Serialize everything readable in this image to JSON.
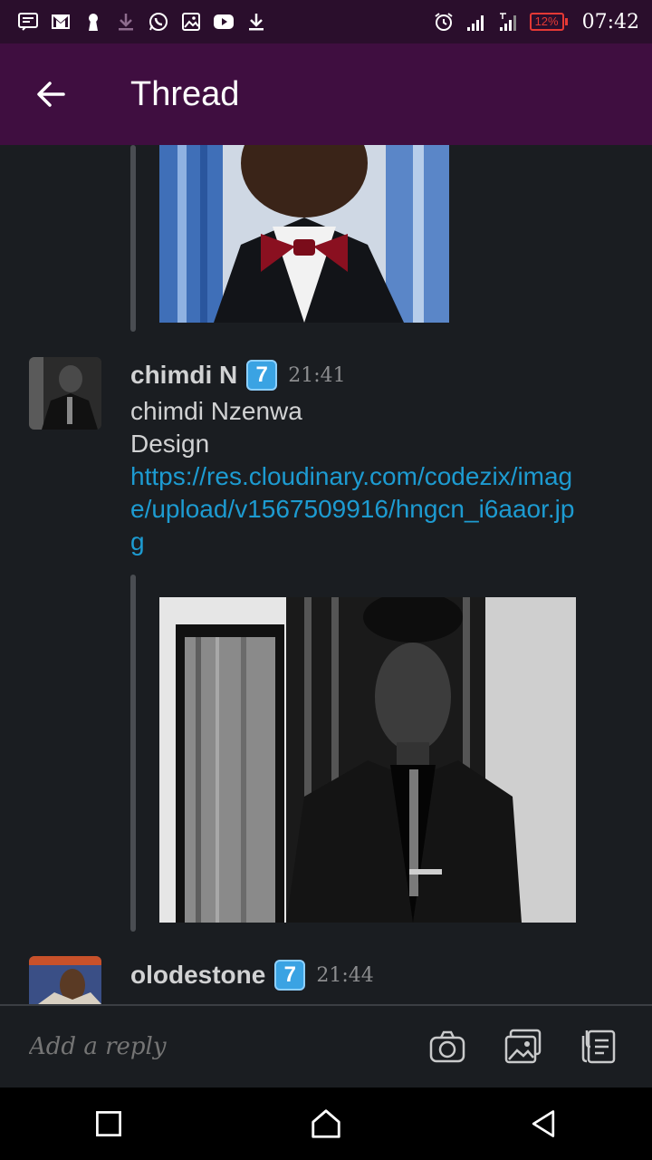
{
  "status_bar": {
    "time": "07:42",
    "battery": "12%",
    "notification_icons": [
      "message-icon",
      "gmail-icon",
      "keyhole-icon",
      "download-icon",
      "whatsapp-icon",
      "image-icon",
      "youtube-icon",
      "download-icon"
    ],
    "system_icons": [
      "alarm-icon",
      "signal-icon",
      "signal-icon",
      "battery-icon"
    ]
  },
  "app_bar": {
    "title": "Thread",
    "back_icon": "arrow-left-icon"
  },
  "messages": [
    {
      "author": "chimdi N",
      "badge": "7",
      "time": "21:41",
      "lines": [
        "chimdi Nzenwa",
        "Design"
      ],
      "link": "https://res.cloudinary.com/codezix/image/upload/v1567509916/hngcn_i6aaor.jpg"
    },
    {
      "author": "olodestone",
      "badge": "7",
      "time": "21:44"
    }
  ],
  "composer": {
    "placeholder": "Add a reply",
    "icons": [
      "camera-icon",
      "gallery-icon",
      "files-icon"
    ]
  },
  "nav_bar": {
    "icons": [
      "recents-icon",
      "home-icon",
      "back-icon"
    ]
  },
  "colors": {
    "status_bar_bg": "#2a0e2c",
    "app_bar_bg": "#3f0e40",
    "content_bg": "#1a1d21",
    "link": "#1d9bd1",
    "badge": "#3aa3e3",
    "battery_low": "#e53935"
  }
}
